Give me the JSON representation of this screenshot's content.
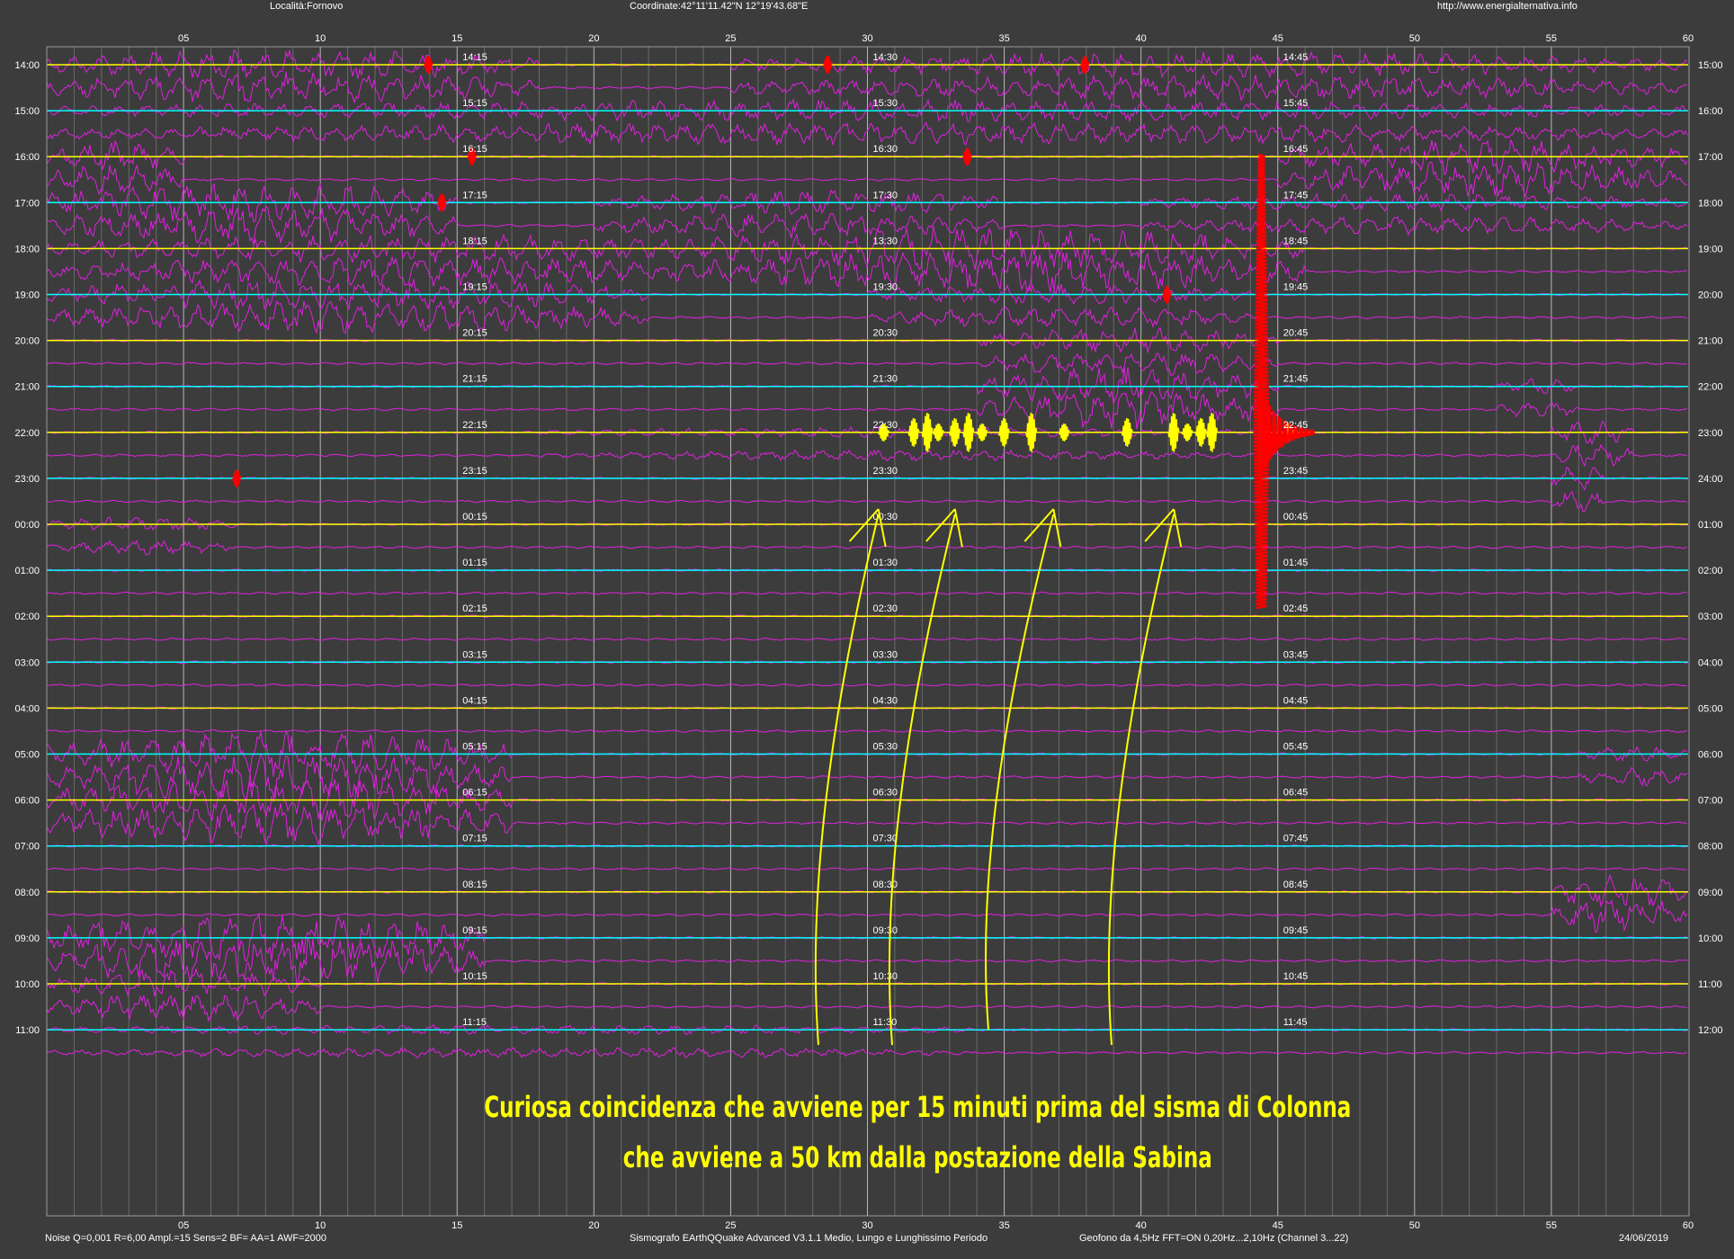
{
  "header": {
    "location": "Località:Fornovo",
    "coordinates": "Coordinate:42°11'11.42\"N  12°19'43.68\"E",
    "website": "http://www.energialternativa.info"
  },
  "footer": {
    "settings": "Noise Q=0,001 R=6,00 Ampl.=15 Sens=2 BF= AA=1 AWF=2000",
    "software": "Sismografo  EArthQQuake Advanced V3.1.1  Medio, Lungo e Lunghissimo Periodo",
    "sensor": "Geofono da 4,5Hz FFT=ON 0,20Hz...2,10Hz      (Channel 3...22)",
    "date": "24/06/2019"
  },
  "annotation": {
    "line1": "Curiosa coincidenza che avviene per 15 minuti prima del sisma di Colonna",
    "line2": "che avviene a 50 km dalla postazione della Sabina"
  },
  "colors": {
    "background": "#3c3c3c",
    "trace": "#e020e0",
    "hour_yellow": "#ffff00",
    "hour_cyan": "#00ffff",
    "event": "#ff0000",
    "annotation": "#ffff00"
  },
  "chart_data": {
    "type": "line",
    "title": "",
    "x_axis": {
      "unit": "minutes",
      "range": [
        0,
        60
      ],
      "tick_labels": [
        "05",
        "10",
        "15",
        "20",
        "25",
        "30",
        "35",
        "40",
        "45",
        "50",
        "55",
        "60"
      ]
    },
    "left_hour_labels": [
      "14:00",
      "15:00",
      "16:00",
      "17:00",
      "18:00",
      "19:00",
      "20:00",
      "21:00",
      "22:00",
      "23:00",
      "00:00",
      "01:00",
      "02:00",
      "03:00",
      "04:00",
      "05:00",
      "06:00",
      "07:00",
      "08:00",
      "09:00",
      "10:00",
      "11:00"
    ],
    "right_hour_labels": [
      "15:00",
      "16:00",
      "17:00",
      "18:00",
      "19:00",
      "20:00",
      "21:00",
      "22:00",
      "23:00",
      "24:00",
      "01:00",
      "02:00",
      "03:00",
      "04:00",
      "05:00",
      "06:00",
      "07:00",
      "08:00",
      "09:00",
      "10:00",
      "11:00",
      "12:00"
    ],
    "quarter_labels_15": [
      "14:15",
      "15:15",
      "16:15",
      "17:15",
      "18:15",
      "19:15",
      "20:15",
      "21:15",
      "22:15",
      "23:15",
      "00:15",
      "01:15",
      "02:15",
      "03:15",
      "04:15",
      "05:15",
      "06:15",
      "07:15",
      "08:15",
      "09:15",
      "10:15",
      "11:15"
    ],
    "quarter_labels_30": [
      "14:30",
      "15:30",
      "16:30",
      "17:30",
      "13:30",
      "19:30",
      "20:30",
      "21:30",
      "22:30",
      "23:30",
      "00:30",
      "01:30",
      "02:30",
      "03:30",
      "04:30",
      "05:30",
      "06:30",
      "07:30",
      "08:30",
      "09:30",
      "10:30",
      "11:30"
    ],
    "quarter_labels_45": [
      "14:45",
      "15:45",
      "16:45",
      "17:45",
      "18:45",
      "19:45",
      "20:45",
      "21:45",
      "22:45",
      "23:45",
      "00:45",
      "01:45",
      "02:45",
      "03:45",
      "04:45",
      "05:45",
      "06:45",
      "07:45",
      "08:45",
      "09:45",
      "10:45",
      "11:45"
    ],
    "quarter_minutes": [
      15,
      30,
      45
    ],
    "hour_line_colors": [
      "yellow",
      "cyan",
      "yellow",
      "cyan",
      "yellow",
      "cyan",
      "yellow",
      "cyan",
      "yellow",
      "cyan",
      "yellow",
      "cyan",
      "yellow",
      "cyan",
      "yellow",
      "cyan",
      "yellow",
      "cyan",
      "yellow",
      "cyan",
      "yellow",
      "cyan"
    ],
    "main_event": {
      "hour_row": "22:00",
      "minute": 44.4
    },
    "precursor_pulses_hour_row": "22:00",
    "precursor_pulses_minutes": [
      30.4,
      31.5,
      32.0,
      32.4,
      33.0,
      33.5,
      34.0,
      34.8,
      35.8,
      37.0,
      39.3,
      41.0,
      41.5,
      42.0,
      42.4,
      45.2
    ],
    "red_events": [
      {
        "hour_row": "14:00",
        "minute": 13.8
      },
      {
        "hour_row": "14:00",
        "minute": 28.4
      },
      {
        "hour_row": "14:00",
        "minute": 37.8
      },
      {
        "hour_row": "16:00",
        "minute": 15.4
      },
      {
        "hour_row": "16:00",
        "minute": 33.5
      },
      {
        "hour_row": "17:00",
        "minute": 14.3
      },
      {
        "hour_row": "19:00",
        "minute": 40.8
      },
      {
        "hour_row": "22:00",
        "minute": 35.8
      },
      {
        "hour_row": "22:00",
        "minute": 41.1
      },
      {
        "hour_row": "23:00",
        "minute": 6.8
      }
    ],
    "arrows_point_to_minutes": [
      30.4,
      33.2,
      36.8,
      41.2
    ],
    "grid": true
  }
}
